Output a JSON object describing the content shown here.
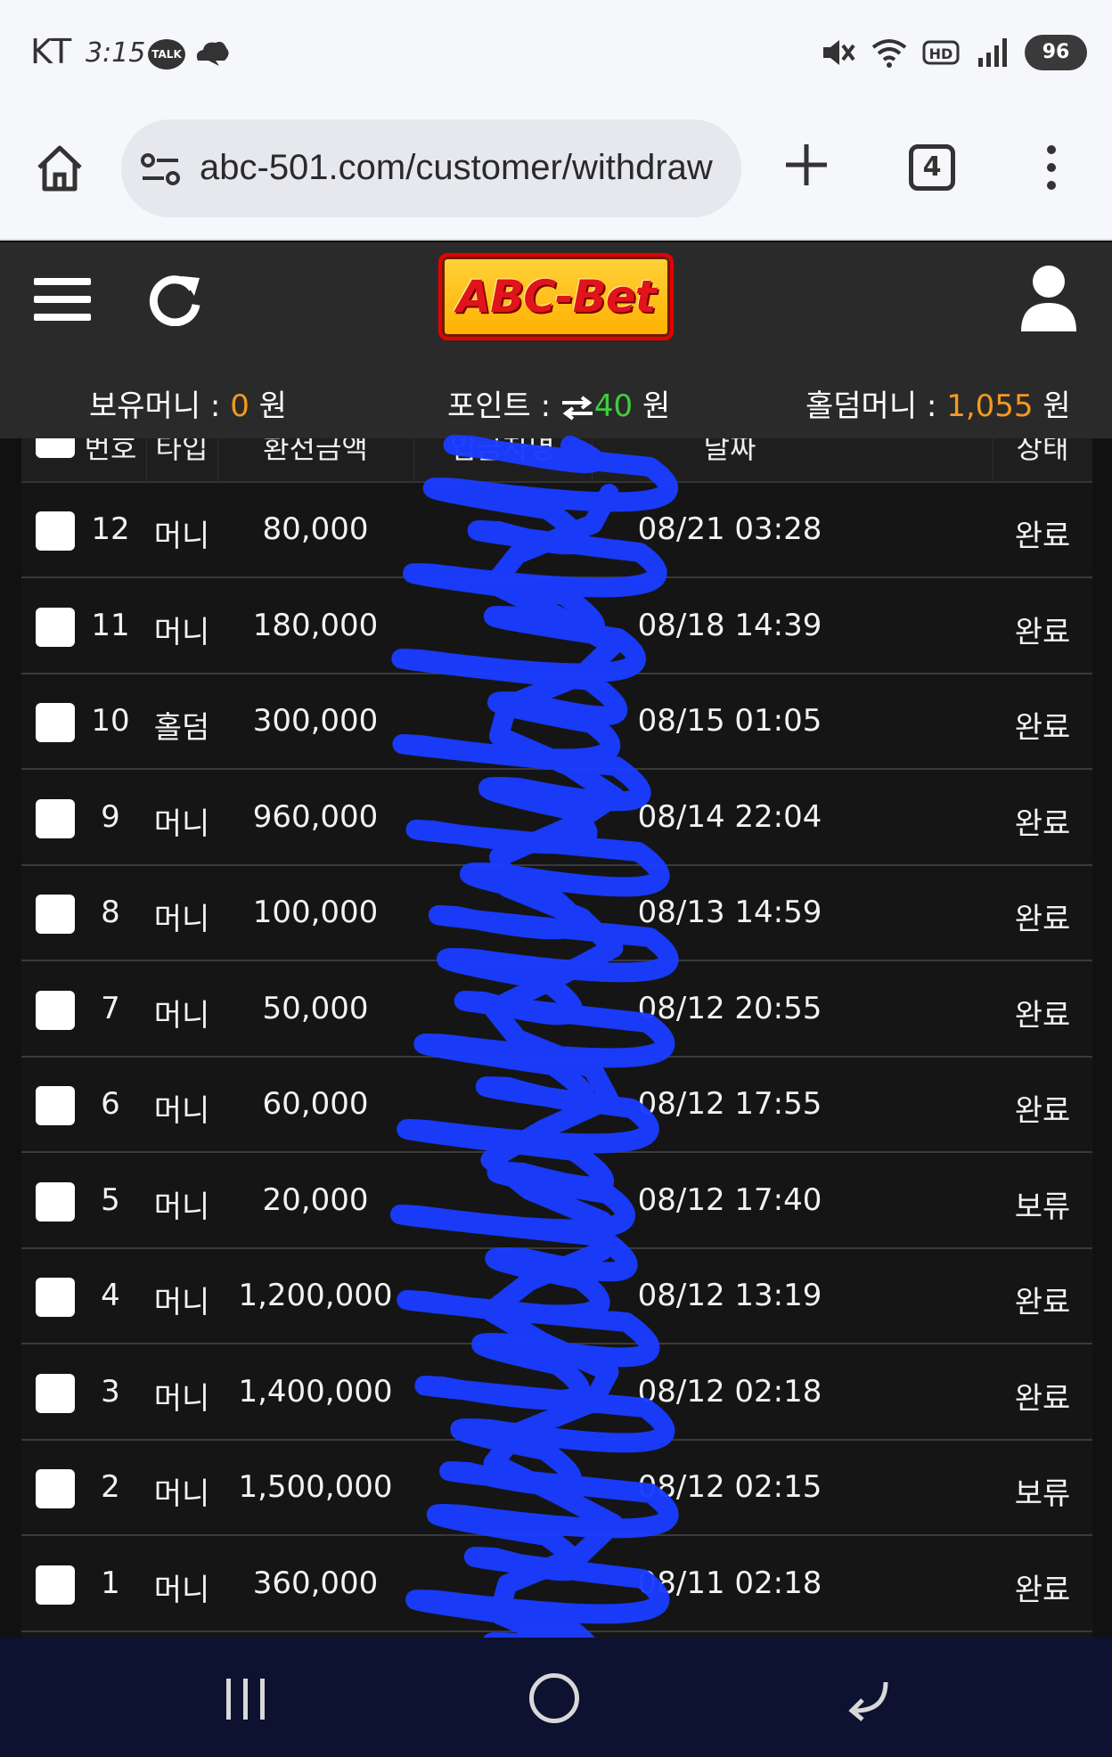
{
  "status_bar": {
    "carrier": "KT",
    "time": "3:15",
    "talk_badge": "TALK",
    "battery": "96",
    "icons": [
      "kakaotalk-icon",
      "cloud-icon",
      "mute-icon",
      "wifi-icon",
      "hd-icon",
      "signal-icon",
      "battery-icon"
    ]
  },
  "browser": {
    "url": "abc-501.com/customer/withdraw",
    "tab_count": "4",
    "icons": [
      "home-icon",
      "site-settings-icon",
      "plus-icon",
      "tabs-icon",
      "more-vert-icon"
    ]
  },
  "site": {
    "logo_text": "ABC-Bet",
    "icons": [
      "menu-icon",
      "refresh-icon",
      "user-icon"
    ]
  },
  "balances": {
    "money_label": "보유머니 : ",
    "money_value": "0",
    "money_unit": " 원",
    "points_label": "포인트 : ",
    "points_value": "40",
    "points_unit": " 원",
    "holdem_label": "홀덤머니 : ",
    "holdem_value": "1,055",
    "holdem_unit": " 원"
  },
  "table": {
    "headers": [
      "번호",
      "타입",
      "환전금액",
      "입금자명",
      "날짜",
      "상태"
    ],
    "rows": [
      {
        "no": "12",
        "type": "머니",
        "amount": "80,000",
        "date": "08/21 03:28",
        "status": "완료"
      },
      {
        "no": "11",
        "type": "머니",
        "amount": "180,000",
        "date": "08/18 14:39",
        "status": "완료"
      },
      {
        "no": "10",
        "type": "홀덤",
        "amount": "300,000",
        "date": "08/15 01:05",
        "status": "완료"
      },
      {
        "no": "9",
        "type": "머니",
        "amount": "960,000",
        "date": "08/14 22:04",
        "status": "완료"
      },
      {
        "no": "8",
        "type": "머니",
        "amount": "100,000",
        "date": "08/13 14:59",
        "status": "완료"
      },
      {
        "no": "7",
        "type": "머니",
        "amount": "50,000",
        "date": "08/12 20:55",
        "status": "완료"
      },
      {
        "no": "6",
        "type": "머니",
        "amount": "60,000",
        "date": "08/12 17:55",
        "status": "완료"
      },
      {
        "no": "5",
        "type": "머니",
        "amount": "20,000",
        "date": "08/12 17:40",
        "status": "보류"
      },
      {
        "no": "4",
        "type": "머니",
        "amount": "1,200,000",
        "date": "08/12 13:19",
        "status": "완료"
      },
      {
        "no": "3",
        "type": "머니",
        "amount": "1,400,000",
        "date": "08/12 02:18",
        "status": "완료"
      },
      {
        "no": "2",
        "type": "머니",
        "amount": "1,500,000",
        "date": "08/12 02:15",
        "status": "보류"
      },
      {
        "no": "1",
        "type": "머니",
        "amount": "360,000",
        "date": "08/11 02:18",
        "status": "완료"
      }
    ]
  },
  "colors": {
    "header_bg": "#2a2a2a",
    "table_bg": "#151515",
    "accent_orange": "#f39a1e",
    "accent_green": "#3ccf3c",
    "redaction_blue": "#1a3cff",
    "nav_bg": "#0d1230"
  }
}
